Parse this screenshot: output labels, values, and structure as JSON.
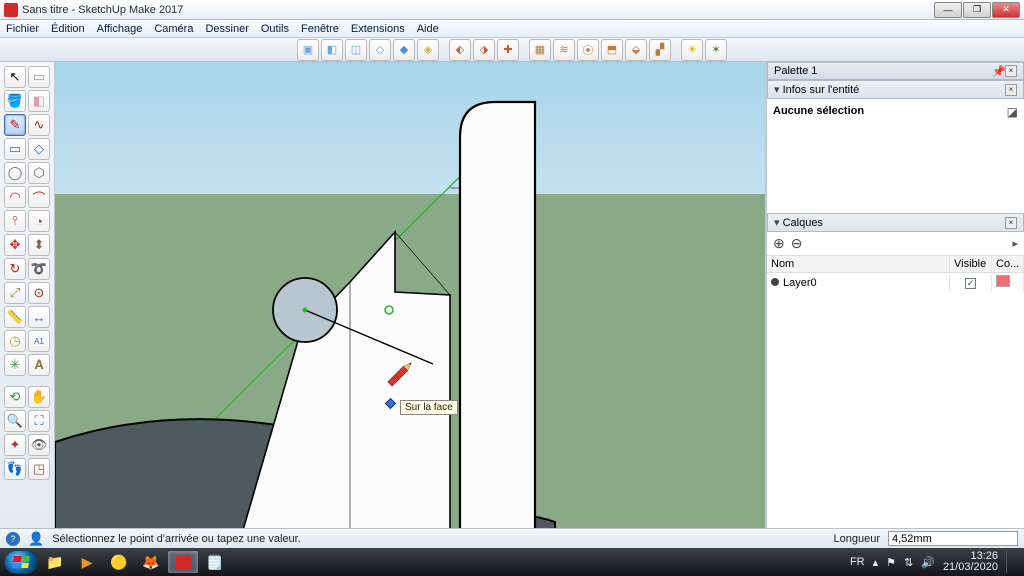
{
  "window": {
    "title": "Sans titre - SketchUp Make 2017"
  },
  "menu": {
    "items": [
      "Fichier",
      "Édition",
      "Affichage",
      "Caméra",
      "Dessiner",
      "Outils",
      "Fenêtre",
      "Extensions",
      "Aide"
    ]
  },
  "panels": {
    "palette_title": "Palette 1",
    "entity_info_title": "Infos sur l'entité",
    "entity_info_body": "Aucune sélection",
    "layers_title": "Calques",
    "layers_cols": {
      "name": "Nom",
      "visible": "Visible",
      "color": "Co..."
    },
    "layers_rows": [
      {
        "name": "Layer0",
        "visible": true,
        "color": "#f26d6d"
      }
    ]
  },
  "viewport": {
    "tooltip": "Sur la face"
  },
  "status": {
    "hint": "Sélectionnez le point d'arrivée ou tapez une valeur.",
    "measure_label": "Longueur",
    "measure_value": "4,52mm"
  },
  "taskbar": {
    "lang": "FR",
    "time": "13:26",
    "date": "21/03/2020"
  }
}
